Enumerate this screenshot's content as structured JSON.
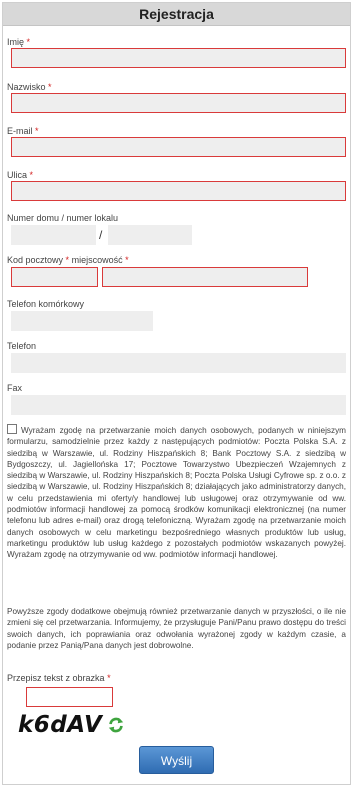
{
  "form": {
    "title": "Rejestracja",
    "required_mark": "*",
    "fields": {
      "imie": {
        "label": "Imię"
      },
      "nazwisko": {
        "label": "Nazwisko"
      },
      "email": {
        "label": "E-mail"
      },
      "ulica": {
        "label": "Ulica"
      },
      "numer": {
        "label": "Numer domu / numer lokalu",
        "separator": "/"
      },
      "kod": {
        "label": "Kod pocztowy",
        "label2": "miejscowość"
      },
      "telefon_kom": {
        "label": "Telefon komórkowy"
      },
      "telefon": {
        "label": "Telefon"
      },
      "fax": {
        "label": "Fax"
      }
    },
    "consent_text": "Wyrażam zgodę na przetwarzanie moich danych osobowych, podanych w niniejszym formularzu, samodzielnie przez każdy z następujących podmiotów: Poczta Polska S.A. z siedzibą w Warszawie, ul. Rodziny Hiszpańskich 8; Bank Pocztowy S.A. z siedzibą w Bydgoszczy, ul. Jagiellońska 17; Pocztowe Towarzystwo Ubezpieczeń Wzajemnych z siedzibą w Warszawie, ul. Rodziny Hiszpańskich 8; Poczta Polska Usługi Cyfrowe sp. z o.o. z siedzibą w Warszawie, ul. Rodziny Hiszpańskich 8; działających jako administratorzy danych, w celu przedstawienia mi oferty/y handlowej lub usługowej oraz otrzymywanie od ww. podmiotów informacji handlowej za pomocą środków komunikacji elektronicznej (na numer telefonu lub adres e-mail) oraz drogą telefoniczną. Wyrażam zgodę na przetwarzanie moich danych osobowych w celu marketingu bezpośredniego własnych produktów lub usług, marketingu produktów lub usług każdego z pozostałych podmiotów wskazanych powyżej. Wyrażam zgodę na otrzymywanie od ww. podmiotów informacji handlowej.",
    "note_text": "Powyższe zgody dodatkowe obejmują również przetwarzanie danych w przyszłości, o ile nie zmieni się cel przetwarzania. Informujemy, że przysługuje Pani/Panu prawo dostępu do treści swoich danych, ich poprawiania oraz odwołania wyrażonej zgody w każdym czasie, a podanie przez Panią/Pana danych jest dobrowolne.",
    "captcha": {
      "label": "Przepisz tekst z obrazka",
      "image_text": "k6dAV"
    },
    "submit_label": "Wyślij",
    "colors": {
      "error_border": "#d93a3a",
      "required": "#d32020",
      "button": "#3d7dc4"
    }
  }
}
